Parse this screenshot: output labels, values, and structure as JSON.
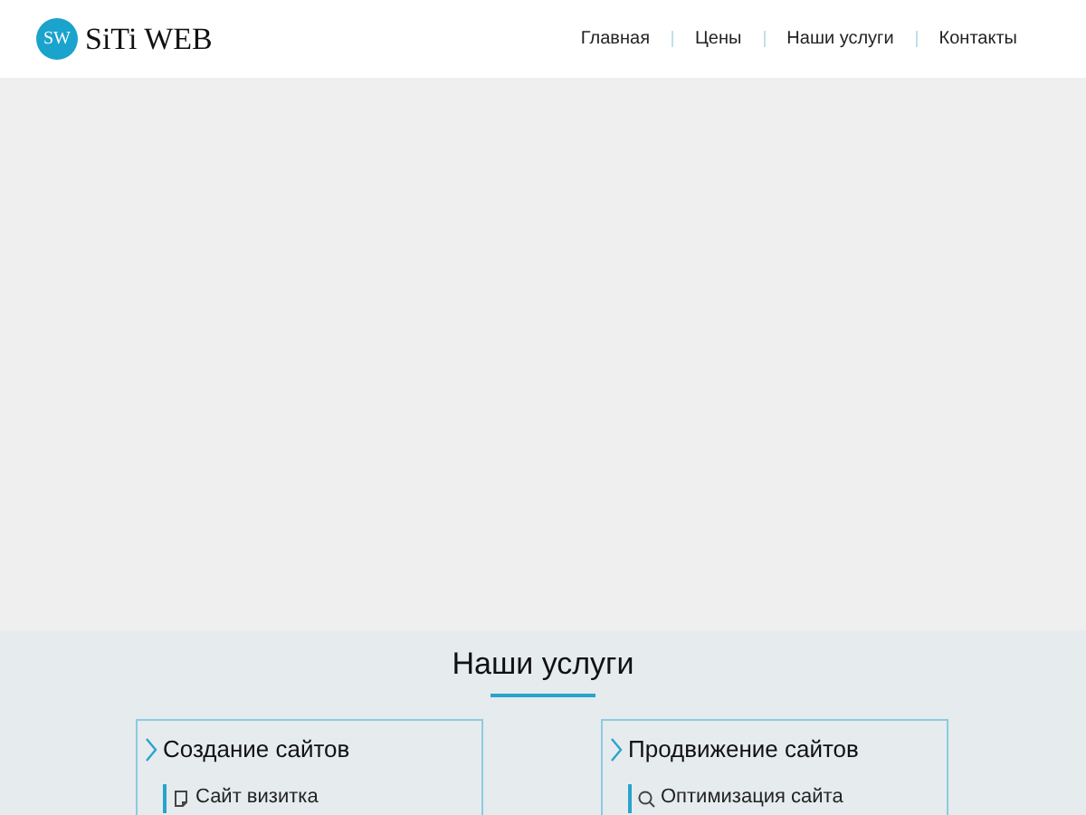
{
  "logo": {
    "badge": "SW",
    "name": "SiTi WEB"
  },
  "nav": [
    "Главная",
    "Цены",
    "Наши услуги",
    "Контакты"
  ],
  "services": {
    "title": "Наши услуги",
    "cards": [
      {
        "title": "Создание сайтов",
        "items": [
          {
            "label": "Сайт визитка",
            "kind": "page"
          }
        ]
      },
      {
        "title": "Продвижение сайтов",
        "items": [
          {
            "label": "Оптимизация сайта",
            "kind": "search"
          }
        ]
      }
    ]
  }
}
